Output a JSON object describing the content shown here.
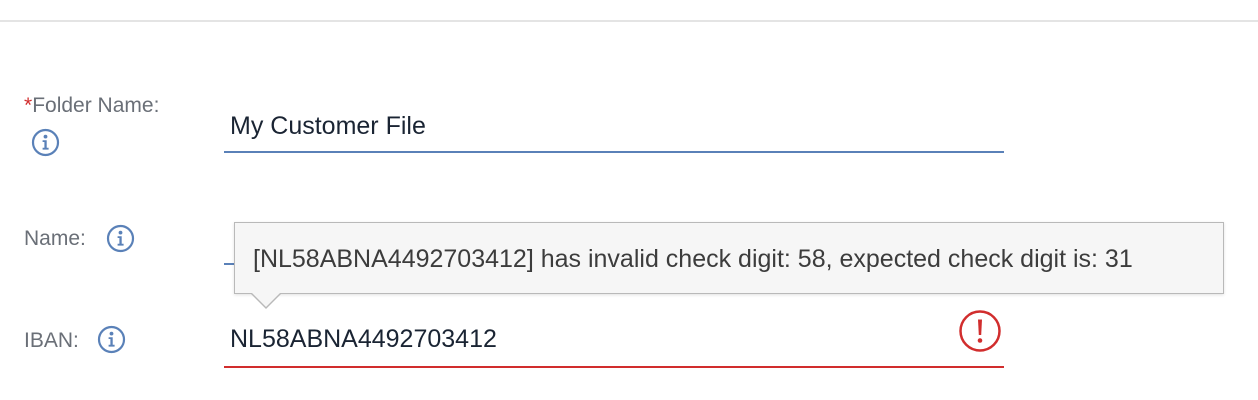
{
  "form": {
    "folder_name": {
      "required_marker": "*",
      "label": "Folder Name:",
      "value": "My Customer File",
      "info_icon": "info-icon"
    },
    "name": {
      "label": "Name:",
      "value": "",
      "info_icon": "info-icon"
    },
    "iban": {
      "label": "IBAN:",
      "value": "NL58ABNA4492703412",
      "info_icon": "info-icon",
      "error_icon": "exclamation-circle-icon"
    }
  },
  "tooltip": {
    "text": "[NL58ABNA4492703412] has invalid check digit: 58, expected check digit is: 31"
  },
  "colors": {
    "accent": "#5a81b8",
    "error": "#d12d2d",
    "label": "#6a6f77",
    "value": "#1a2433"
  }
}
